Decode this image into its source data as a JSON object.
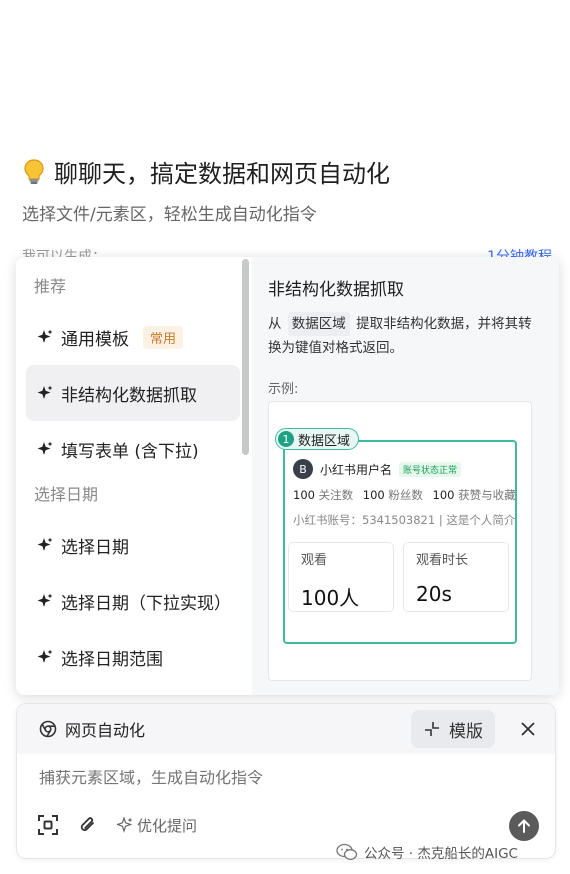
{
  "hero": {
    "title": "聊聊天，搞定数据和网页自动化",
    "subtitle": "选择文件/元素区，轻松生成自动化指令",
    "peek_left": "我可以生成：",
    "peek_right": "1分钟教程"
  },
  "menu": {
    "groups": [
      {
        "title": "推荐",
        "items": [
          {
            "label": "通用模板",
            "tag": "常用"
          },
          {
            "label": "非结构化数据抓取"
          },
          {
            "label": "填写表单 (含下拉)"
          }
        ]
      },
      {
        "title": "选择日期",
        "items": [
          {
            "label": "选择日期"
          },
          {
            "label": "选择日期（下拉实现）"
          },
          {
            "label": "选择日期范围"
          }
        ]
      }
    ]
  },
  "preview": {
    "title": "非结构化数据抓取",
    "desc_prefix": "从",
    "desc_chip": "数据区域",
    "desc_suffix": "提取非结构化数据，并将其转换为键值对格式返回。",
    "example_label": "示例:",
    "example": {
      "region_number": "1",
      "region_label": "数据区域",
      "avatar_letter": "B",
      "username": "小红书用户名",
      "account_status": "账号状态正常",
      "stats": [
        {
          "value": "100",
          "label": "关注数"
        },
        {
          "value": "100",
          "label": "粉丝数"
        },
        {
          "value": "100",
          "label": "获赞与收藏"
        }
      ],
      "desc_line": "小红书账号：5341503821 | 这是个人简介",
      "metrics": [
        {
          "label": "观看",
          "value": "100人"
        },
        {
          "label": "观看时长",
          "value": "20s"
        }
      ]
    }
  },
  "composer": {
    "chip_label": "网页自动化",
    "mode_label": "模版",
    "placeholder": "捕获元素区域，生成自动化指令",
    "optimize_label": "优化提问"
  },
  "watermark": "公众号 · 杰克船长的AIGC",
  "colors": {
    "accent_teal": "#3fb9a0",
    "tag_orange": "#c87a2e",
    "link_blue": "#3b6cf6"
  }
}
